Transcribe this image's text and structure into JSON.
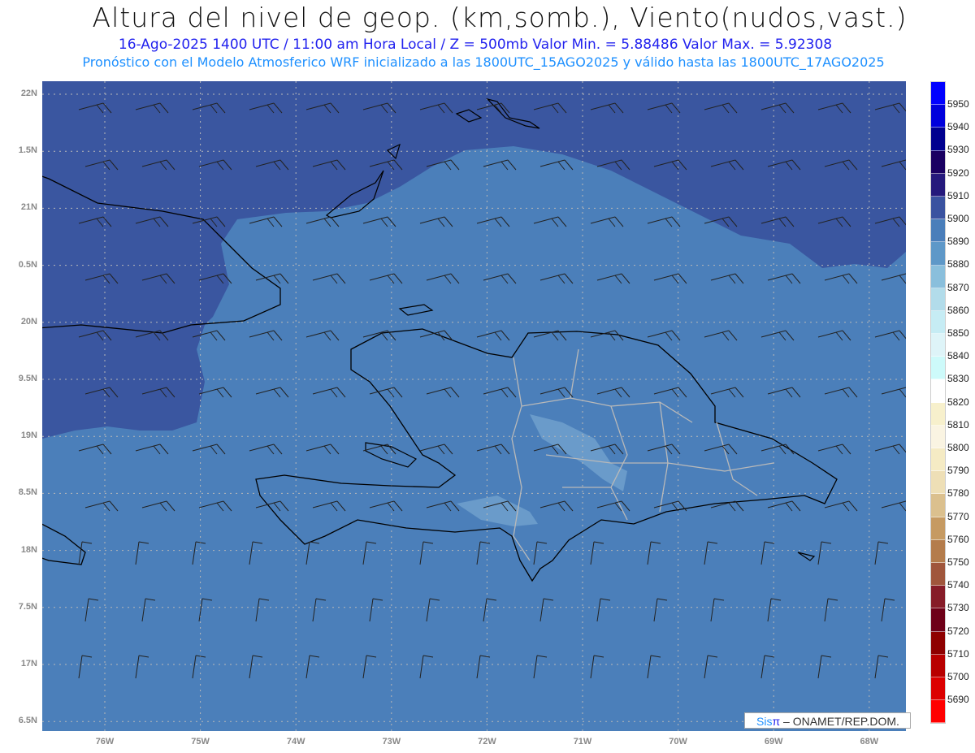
{
  "header": {
    "title": "Altura del nivel de geop. (km,somb.), Viento(nudos,vast.)",
    "subtitle": "16-Ago-2025  1400 UTC / 11:00 am Hora Local / Z = 500mb    Valor Min. = 5.88486   Valor Max. = 5.92308",
    "model_line": "Pronóstico con el Modelo Atmosferico WRF inicializado a las 1800UTC_15AGO2025 y válido hasta las  1800UTC_17AGO2025"
  },
  "lat_labels": [
    "22N",
    "1.5N",
    "21N",
    "0.5N",
    "20N",
    "9.5N",
    "19N",
    "8.5N",
    "18N",
    "7.5N",
    "17N",
    "6.5N"
  ],
  "lon_labels": [
    "76W",
    "75W",
    "74W",
    "73W",
    "72W",
    "71W",
    "70W",
    "69W",
    "68W"
  ],
  "colorbar": {
    "labels": [
      "5950",
      "5940",
      "5930",
      "5920",
      "5910",
      "5900",
      "5890",
      "5880",
      "5870",
      "5860",
      "5850",
      "5840",
      "5830",
      "5820",
      "5810",
      "5800",
      "5790",
      "5780",
      "5770",
      "5760",
      "5750",
      "5740",
      "5730",
      "5720",
      "5710",
      "5700",
      "5690"
    ],
    "colors": [
      "#0000ff",
      "#0000dc",
      "#00008f",
      "#1a0062",
      "#25197c",
      "#3a52a0",
      "#4a7eba",
      "#5e98c8",
      "#8abfdc",
      "#b2dcea",
      "#c6ecf4",
      "#def4f8",
      "#cdfafa",
      "#ffffff",
      "#f7f0cc",
      "#faf4e2",
      "#f5ebc4",
      "#eedfb6",
      "#dbc08e",
      "#c69a62",
      "#b47c4c",
      "#a0563c",
      "#861c28",
      "#6e0018",
      "#8e0000",
      "#b80000",
      "#dc0000",
      "#ff0000"
    ]
  },
  "map_colors": {
    "base": "#4b7fba",
    "north": "#3a56a0",
    "light": "#6a9bca",
    "grid": "#b8b8b8",
    "coast": "#000000",
    "border": "#b9b9b9"
  },
  "credit": {
    "sis": "Sis",
    "pi": "π",
    "rest": " –  ONAMET/REP.DOM."
  }
}
